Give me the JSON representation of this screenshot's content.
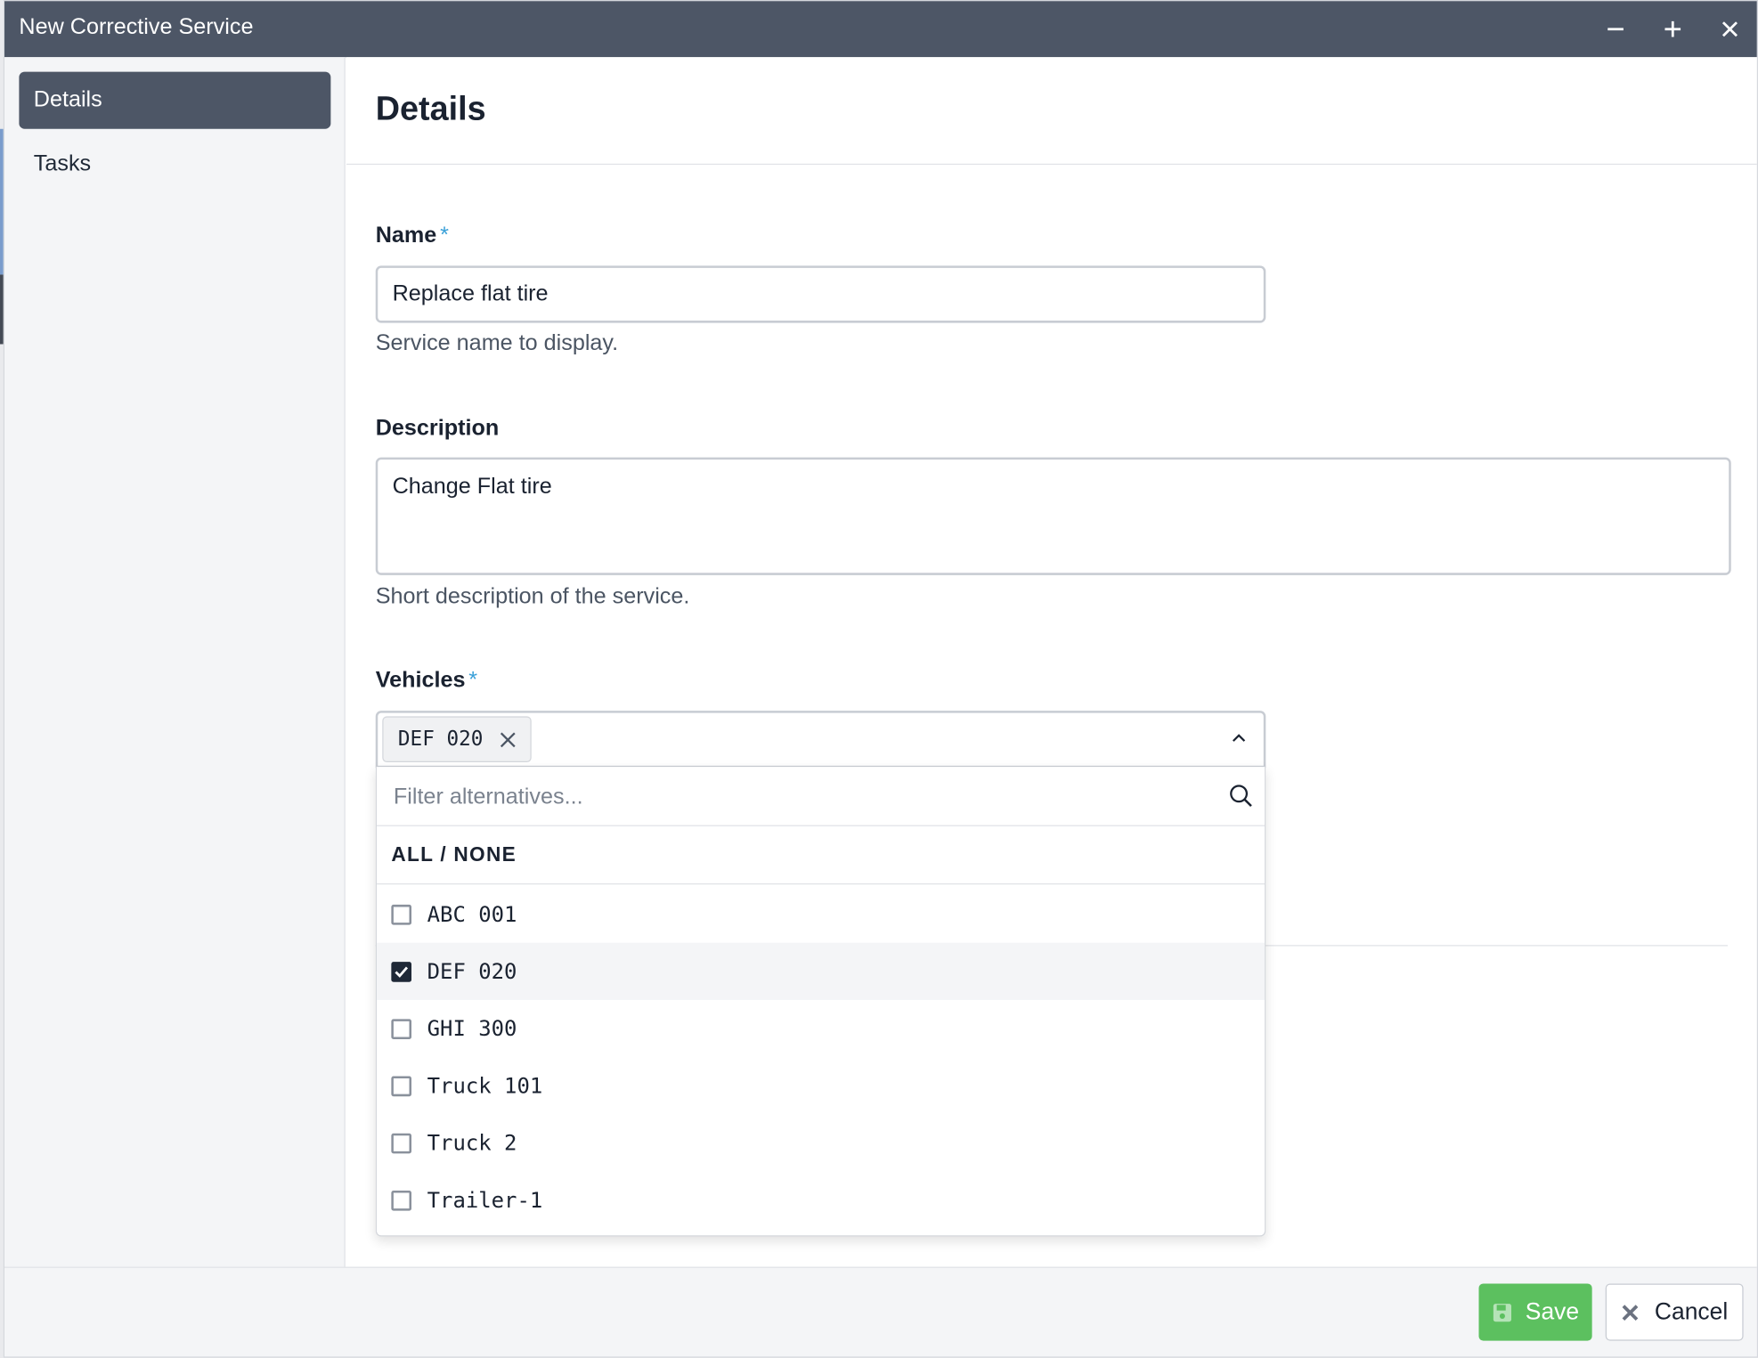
{
  "window": {
    "title": "New Corrective Service",
    "controls": [
      "minimize",
      "maximize",
      "close"
    ]
  },
  "sidebar": {
    "items": [
      {
        "label": "Details",
        "active": true
      },
      {
        "label": "Tasks",
        "active": false
      }
    ]
  },
  "main": {
    "title": "Details",
    "name": {
      "label": "Name",
      "required_mark": "*",
      "value": "Replace flat tire",
      "help": "Service name to display."
    },
    "description": {
      "label": "Description",
      "value": "Change Flat tire",
      "help": "Short description of the service."
    },
    "vehicles": {
      "label": "Vehicles",
      "required_mark": "*",
      "selected_chip": "DEF 020",
      "filter_placeholder": "Filter alternatives...",
      "all_none": "ALL / NONE",
      "options": [
        {
          "label": "ABC 001",
          "checked": false
        },
        {
          "label": "DEF 020",
          "checked": true
        },
        {
          "label": "GHI 300",
          "checked": false
        },
        {
          "label": "Truck 101",
          "checked": false
        },
        {
          "label": "Truck 2",
          "checked": false
        },
        {
          "label": "Trailer-1",
          "checked": false
        }
      ]
    }
  },
  "footer": {
    "save_label": "Save",
    "cancel_label": "Cancel"
  },
  "colors": {
    "titlebar": "#4d5666",
    "accent_required": "#3aa0d8",
    "save_green": "#5cc05f"
  }
}
